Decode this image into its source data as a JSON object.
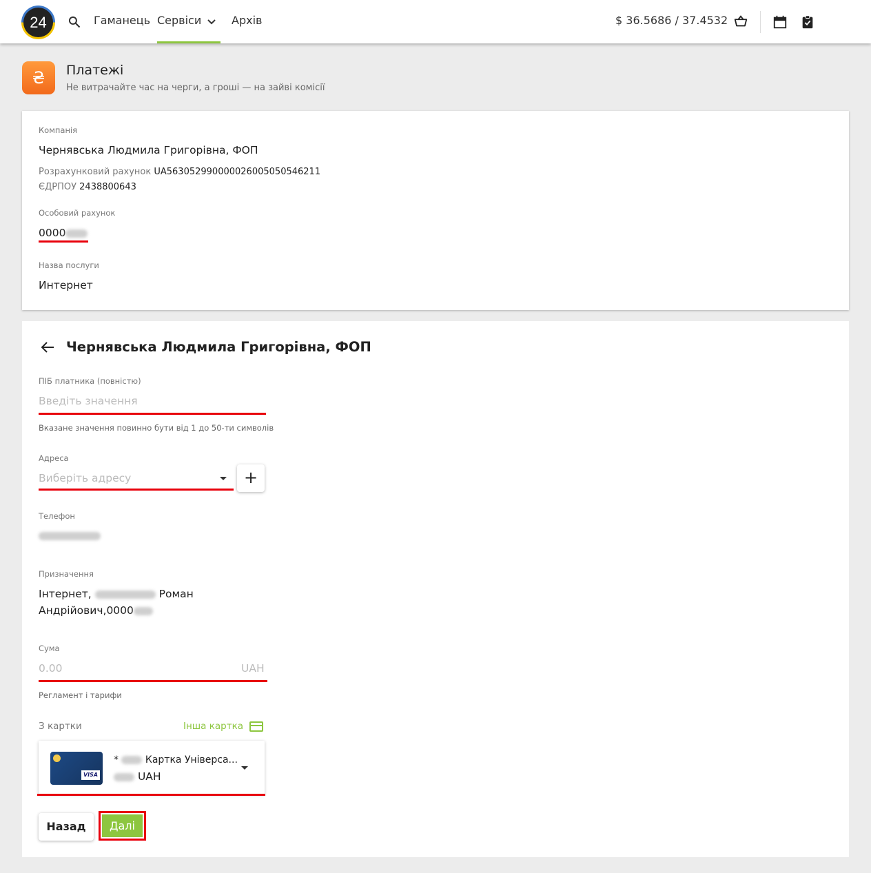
{
  "header": {
    "logo_text": "24",
    "nav": [
      "Гаманець",
      "Сервіси",
      "Архів"
    ],
    "rate": "$  36.5686 / 37.4532"
  },
  "service": {
    "icon_char": "₴",
    "title": "Платежі",
    "subtitle": "Не витрачайте час на черги, а гроші — на зайві комісії"
  },
  "summary": {
    "company_label": "Компанія",
    "company": "Чернявська Людмила Григорівна, ФОП",
    "account_label": "Розрахунковий рахунок",
    "account": "UA563052990000026005050546211",
    "edrpou_label": "ЄДРПОУ",
    "edrpou": "2438800643",
    "personal_label": "Особовий рахунок",
    "personal": "0000",
    "service_label": "Назва послуги",
    "service": "Интернет"
  },
  "form": {
    "title": "Чернявська Людмила Григорівна, ФОП",
    "payer_label": "ПІБ платника (повністю)",
    "payer_placeholder": "Введіть значення",
    "payer_hint": "Вказане значення повинно бути від 1 до 50-ти символів",
    "address_label": "Адреса",
    "address_placeholder": "Виберіть адресу",
    "phone_label": "Телефон",
    "purpose_label": "Призначення",
    "purpose_line1_a": "Інтернет,",
    "purpose_line1_b": "Роман",
    "purpose_line2": "Андрійович,0000",
    "amount_label": "Сума",
    "amount_placeholder": "0.00",
    "currency": "UAH",
    "tariffs": "Регламент і тарифи",
    "from_card_label": "З картки",
    "other_card": "Інша картка",
    "card_name": "Картка Універса...",
    "card_mask": "*",
    "card_currency": "UAH",
    "visa": "VISA",
    "back_button": "Назад",
    "next_button": "Далі"
  },
  "colors": {
    "accent_green": "#8dc63f",
    "highlight_red": "#e8000b",
    "service_orange": "#f26a1b"
  }
}
